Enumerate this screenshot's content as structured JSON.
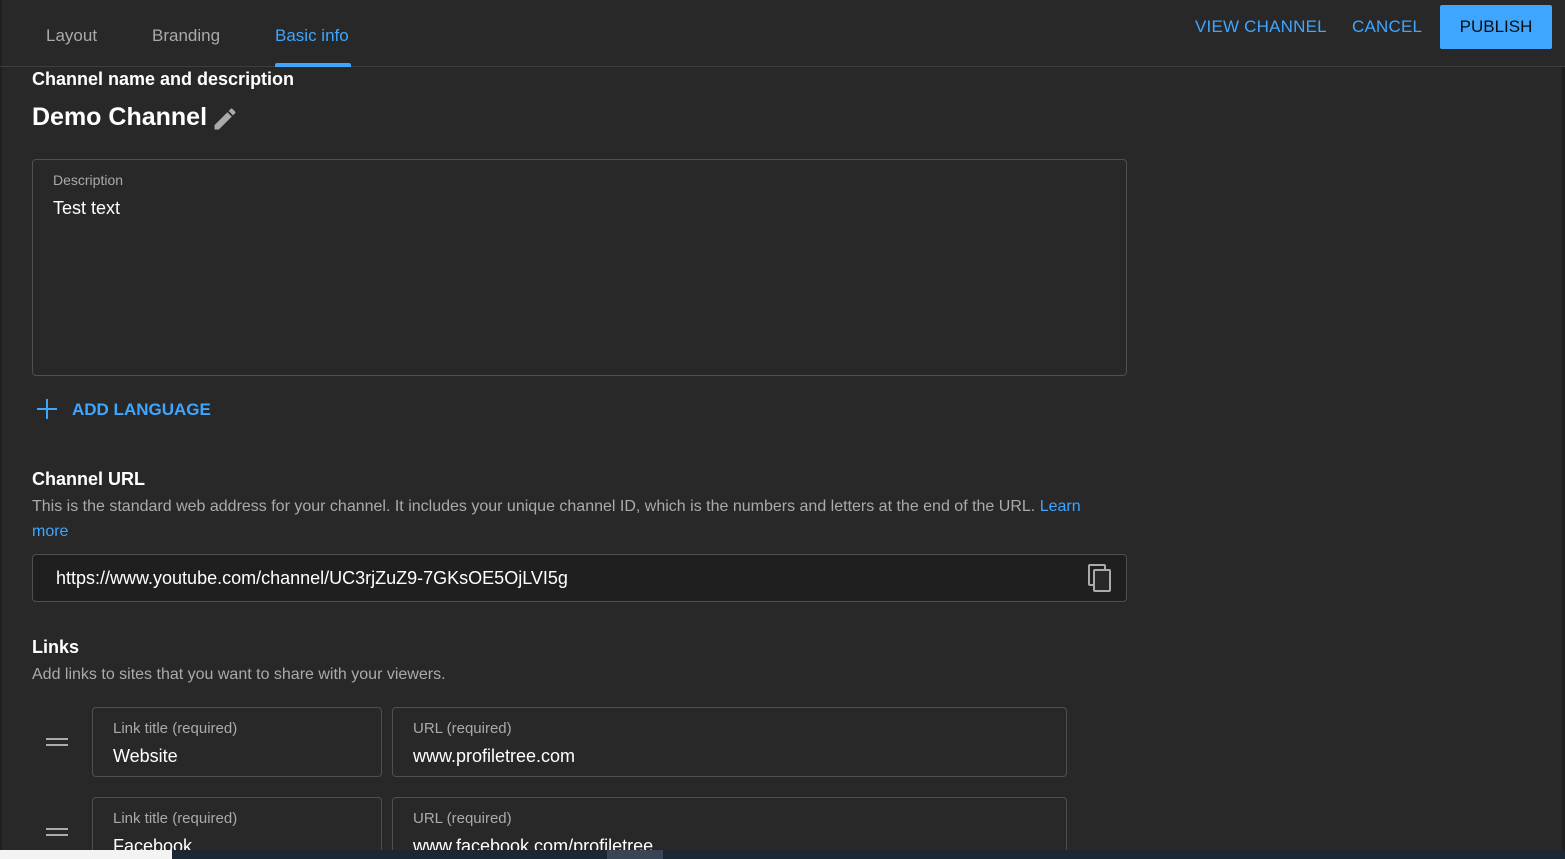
{
  "tabs": [
    {
      "label": "Layout",
      "active": false
    },
    {
      "label": "Branding",
      "active": false
    },
    {
      "label": "Basic info",
      "active": true
    }
  ],
  "header": {
    "view_channel": "VIEW CHANNEL",
    "cancel": "CANCEL",
    "publish": "PUBLISH"
  },
  "name_section": {
    "title": "Channel name and description",
    "channel_name": "Demo Channel",
    "edit_icon": "pencil-icon"
  },
  "description": {
    "label": "Description",
    "value": "Test text"
  },
  "add_language": "ADD LANGUAGE",
  "channel_url": {
    "title": "Channel URL",
    "text": "This is the standard web address for your channel. It includes your unique channel ID, which is the numbers and letters at the end of the URL.",
    "learn_more": "Learn more",
    "learn_more_line1": "Learn",
    "learn_more_line2": "more",
    "url": "https://www.youtube.com/channel/UC3rjZuZ9-7GKsOE5OjLVI5g",
    "copy_icon": "copy-icon"
  },
  "links": {
    "title": "Links",
    "description": "Add links to sites that you want to share with your viewers.",
    "items": [
      {
        "title_label": "Link title (required)",
        "title": "Website",
        "url_label": "URL (required)",
        "url": "www.profiletree.com"
      },
      {
        "title_label": "Link title (required)",
        "title": "Facebook",
        "url_label": "URL (required)",
        "url": "www.facebook.com/profiletree"
      }
    ]
  },
  "colors": {
    "background": "#282828",
    "accent": "#3ea6ff",
    "text_secondary": "#aaaaaa",
    "border": "#4f4f4f"
  }
}
